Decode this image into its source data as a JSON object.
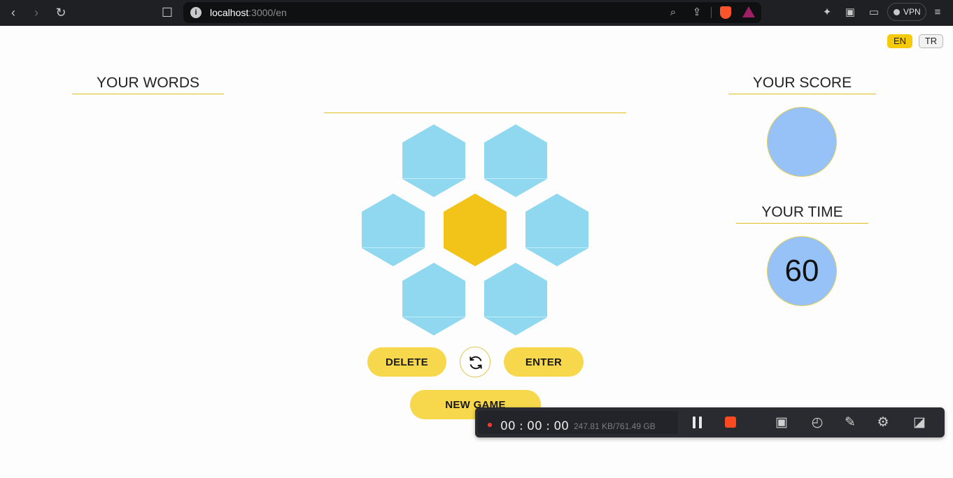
{
  "browser": {
    "url_host": "localhost",
    "url_path": ":3000/en",
    "vpn_label": "VPN",
    "icons": [
      "back-icon",
      "forward-icon",
      "reload-icon",
      "bookmark-icon",
      "info-icon",
      "zoom-icon",
      "share-icon",
      "brave-shields-icon",
      "brave-rewards-icon",
      "extensions-icon",
      "sidebar-icon",
      "wallet-icon",
      "menu-icon"
    ]
  },
  "language": {
    "en": "EN",
    "tr": "TR",
    "active": "EN"
  },
  "words_panel": {
    "title": "YOUR WORDS",
    "words": []
  },
  "word_input": {
    "value": ""
  },
  "hive": {
    "center_letter": "",
    "outer_letters": [
      "",
      "",
      "",
      "",
      "",
      ""
    ]
  },
  "controls": {
    "delete_label": "DELETE",
    "enter_label": "ENTER",
    "new_game_label": "NEW GAME",
    "shuffle_icon": "shuffle-icon"
  },
  "score_panel": {
    "title": "YOUR SCORE",
    "value": ""
  },
  "time_panel": {
    "title": "YOUR TIME",
    "value": "60"
  },
  "recorder": {
    "elapsed": "00 : 00 : 00",
    "size": "247.81 KB/761.49 GB"
  },
  "colors": {
    "accent": "#f2c318",
    "hex_outer": "#8fd8ef",
    "circle": "#97c2f7",
    "button": "#f7d74b",
    "record": "#fb4a1f"
  }
}
